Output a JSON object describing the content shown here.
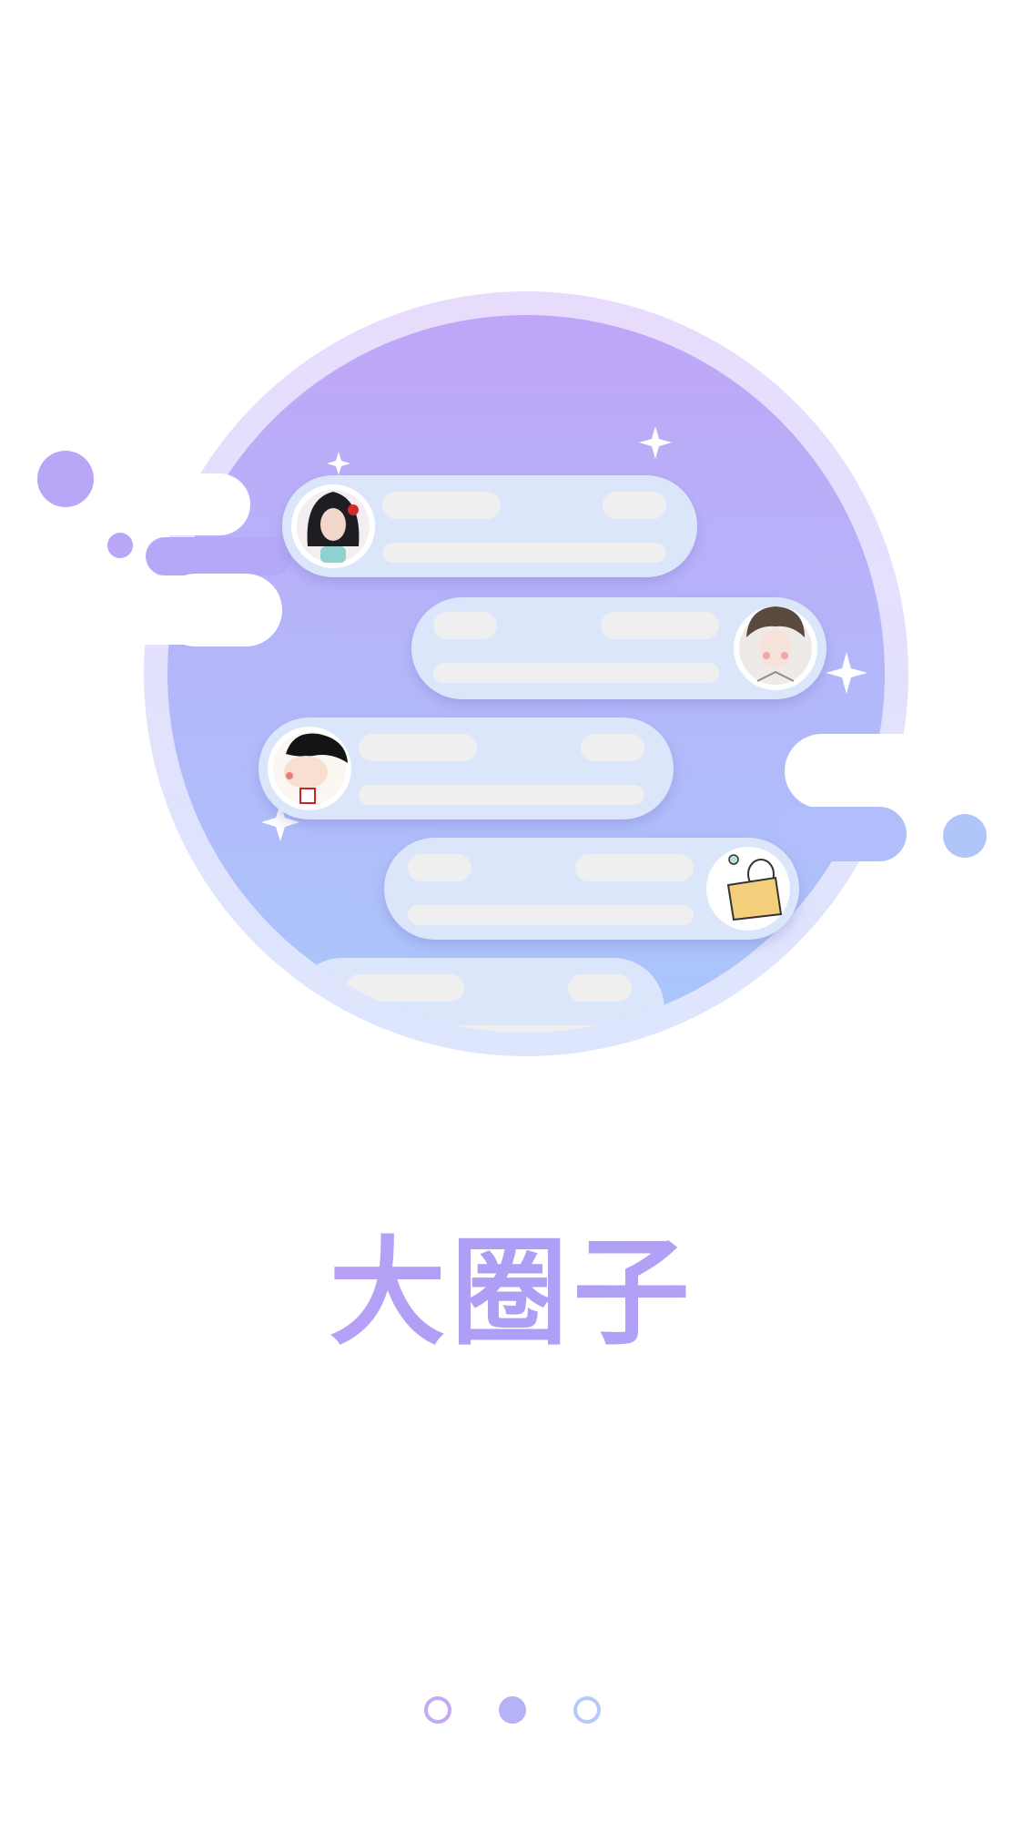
{
  "title": "大圈子",
  "colors": {
    "accent_purple": "#b9a6f7",
    "accent_blue": "#b0c6fb",
    "bubble_fill": "#dce6fb",
    "placeholder_bar": "#efefef"
  },
  "illustration": {
    "avatars": [
      "girl-avatar",
      "man-sketch-avatar",
      "cartoon-girl-avatar",
      "blanket-character-avatar"
    ]
  },
  "pager": {
    "count": 3,
    "active_index": 1
  }
}
